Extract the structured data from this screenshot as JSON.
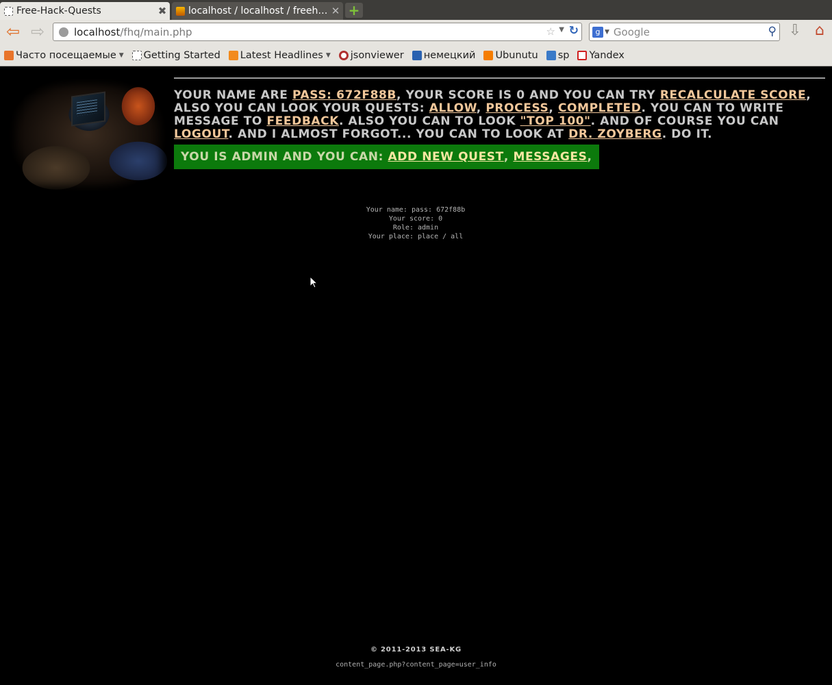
{
  "browser": {
    "tabs": [
      {
        "title": "Free-Hack-Quests",
        "active": true
      },
      {
        "title": "localhost / localhost / freeh…",
        "active": false
      }
    ],
    "url": {
      "host": "localhost",
      "path": "/fhq/main.php"
    },
    "search_placeholder": "Google",
    "bookmarks": [
      {
        "label": "Часто посещаемые",
        "dropdown": true,
        "icon": "most-visited-icon",
        "color": "#e8742a"
      },
      {
        "label": "Getting Started",
        "dropdown": false,
        "icon": "page-icon",
        "color": "#ffffff"
      },
      {
        "label": "Latest Headlines",
        "dropdown": true,
        "icon": "rss-icon",
        "color": "#f28a1d"
      },
      {
        "label": "jsonviewer",
        "dropdown": false,
        "icon": "jsonviewer-icon",
        "color": "#b03030"
      },
      {
        "label": "немецкий",
        "dropdown": false,
        "icon": "b-icon",
        "color": "#2a62b0"
      },
      {
        "label": "Ubunutu",
        "dropdown": false,
        "icon": "blogger-icon",
        "color": "#f57d00"
      },
      {
        "label": "sp",
        "dropdown": false,
        "icon": "cart-icon",
        "color": "#3a7ac8"
      },
      {
        "label": "Yandex",
        "dropdown": false,
        "icon": "yandex-icon",
        "color": "#d02020"
      }
    ]
  },
  "page": {
    "intro": {
      "t1": "Your name are ",
      "name_link": "pass: 672f88b",
      "t2": ", your score is ",
      "score": "0",
      "t3": " and you can try ",
      "recalc_link": "recalculate score",
      "t4": ", also you can look your quests: ",
      "allow_link": "allow",
      "t5": ", ",
      "process_link": "process",
      "t6": ", ",
      "completed_link": "completed",
      "t7": ". You can to write message to ",
      "feedback_link": "feedback",
      "t8": ". Also you can to look ",
      "top_link": "\"top 100\"",
      "t9": ". And of course you can ",
      "logout_link": "logout",
      "t10": ". And I almost forgot... You can to look at ",
      "zoyberg_link": "Dr. Zoyberg",
      "t11": ". Do it."
    },
    "admin": {
      "text": "You is admin and you can: ",
      "add_quest_link": "add new quest",
      "sep1": ", ",
      "messages_link": "messages",
      "sep2": ","
    },
    "user_info": {
      "name": "Your name: pass: 672f88b",
      "score": "Your score: 0",
      "role": "Role: admin",
      "place": "Your place: place / all"
    },
    "copyright": "© 2011-2013 sea-kg",
    "content_page": "content_page.php?content_page=user_info"
  }
}
